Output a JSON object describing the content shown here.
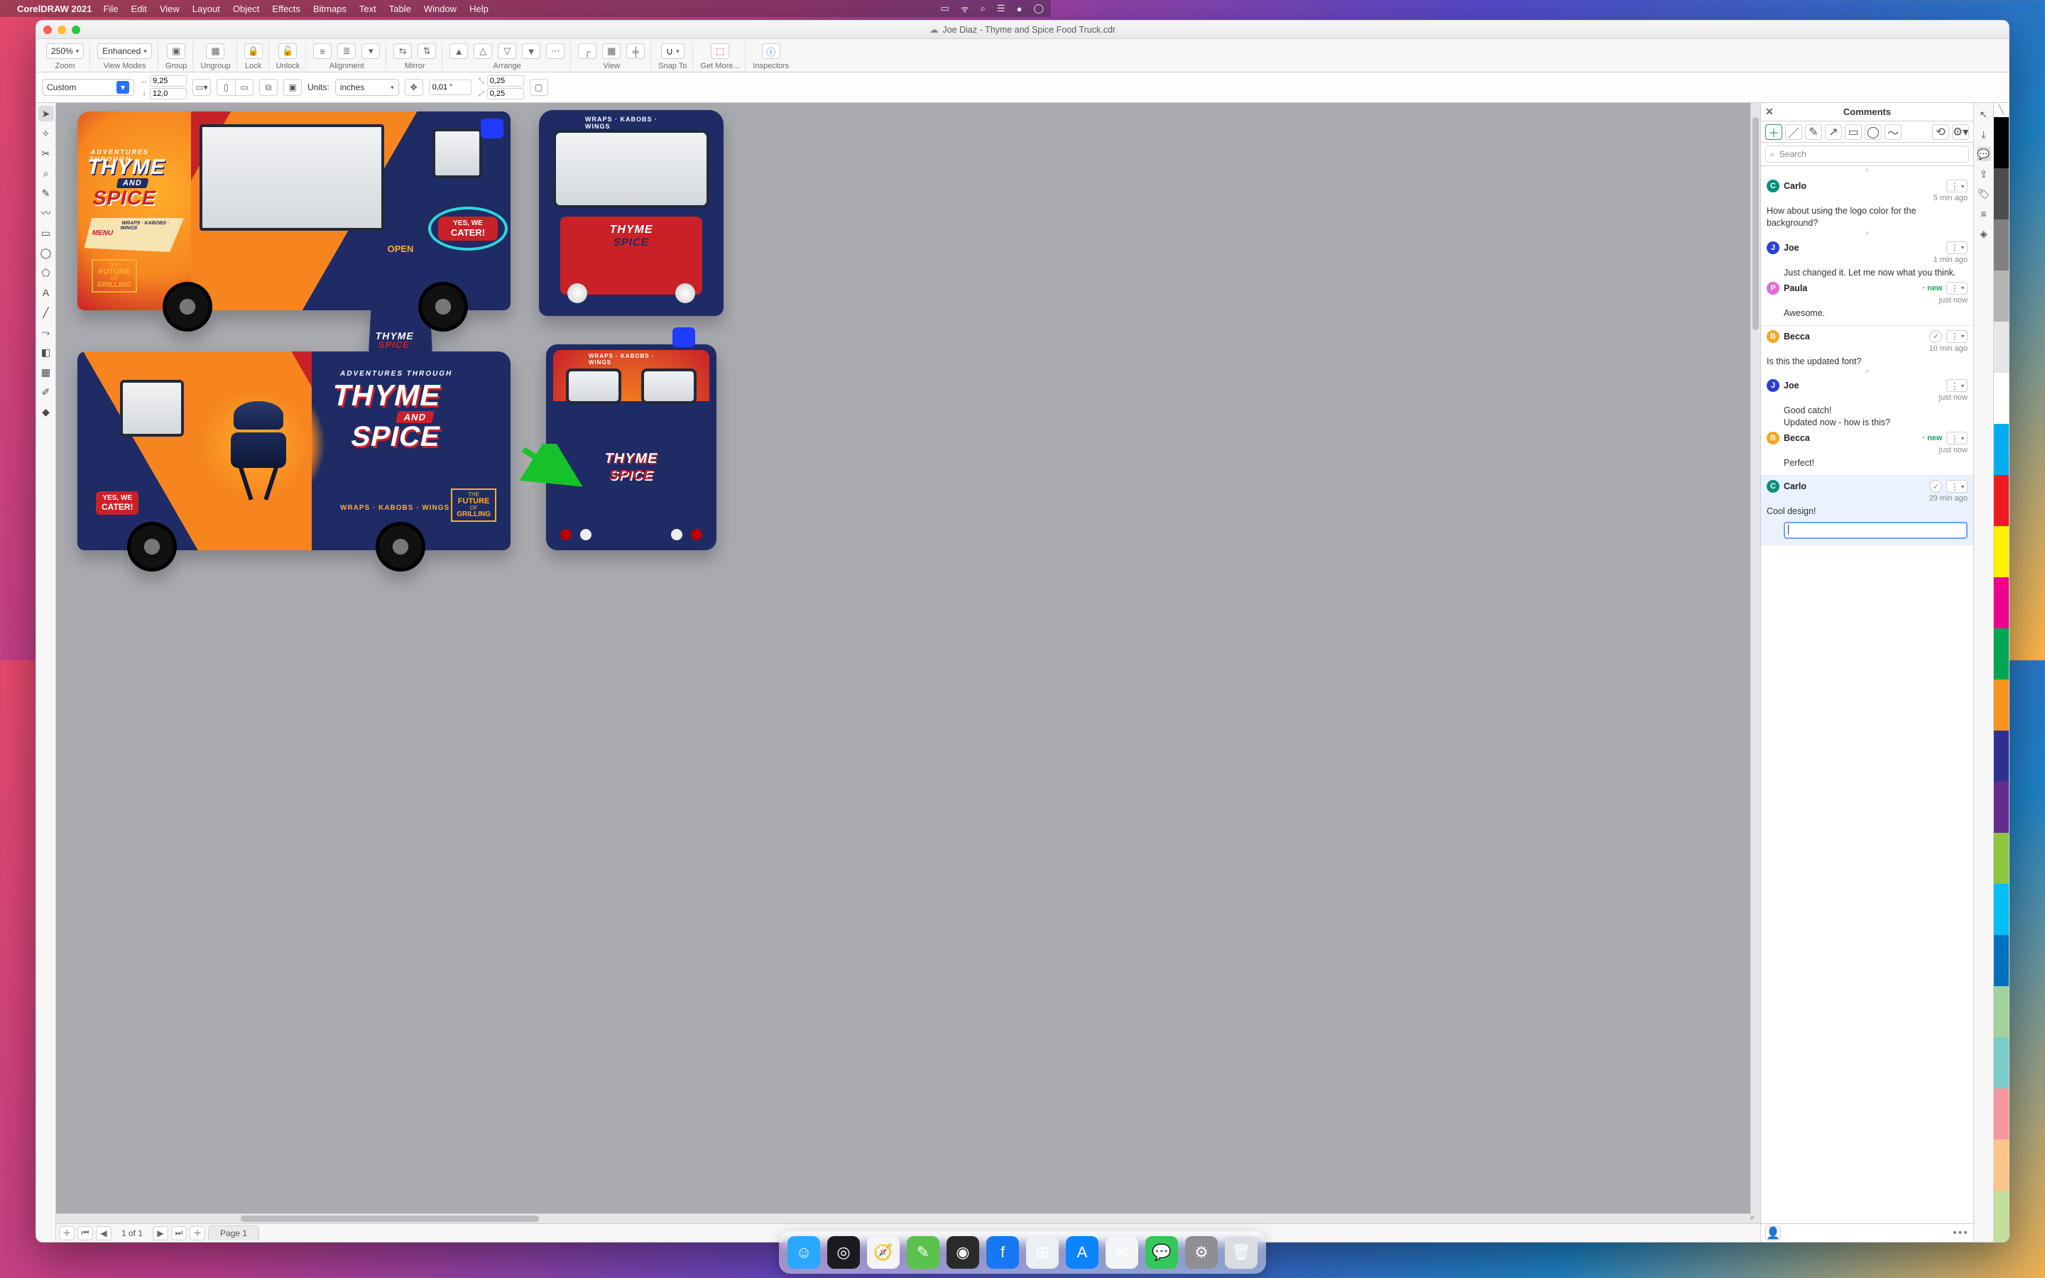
{
  "menubar": {
    "app": "CorelDRAW 2021",
    "items": [
      "File",
      "Edit",
      "View",
      "Layout",
      "Object",
      "Effects",
      "Bitmaps",
      "Text",
      "Table",
      "Window",
      "Help"
    ]
  },
  "window_title": "Joe Diaz - Thyme and Spice Food Truck.cdr",
  "toolbar": {
    "zoom_value": "250% ",
    "zoom_label": "Zoom",
    "viewmodes_value": "Enhanced ",
    "viewmodes_label": "View Modes",
    "group_label": "Group",
    "ungroup_label": "Ungroup",
    "lock_label": "Lock",
    "unlock_label": "Unlock",
    "alignment_label": "Alignment",
    "mirror_label": "Mirror",
    "arrange_label": "Arrange",
    "view_label": "View",
    "snapto_label": "Snap To",
    "getmore_label": "Get More...",
    "inspectors_label": "Inspectors"
  },
  "propbar": {
    "page_preset": "Custom",
    "x": "9,25",
    "y": "12,0",
    "units_label": "Units:",
    "units_value": "inches",
    "nudge": "0,01 \"",
    "dupx": "0,25",
    "dupy": "0,25"
  },
  "canvas_art": {
    "brand_line1": "ADVENTURES THROUGH",
    "brand_thyme": "THYME",
    "brand_and": "AND",
    "brand_spice": "SPICE",
    "tagline": "WRAPS · KABOBS · WINGS",
    "future1": "THE",
    "future2": "FUTURE",
    "future3": "OF",
    "future4": "GRILLING",
    "cater1": "YES, WE",
    "cater2": "CATER!",
    "menu_label": "MENU",
    "open_label": "OPEN"
  },
  "pagetabs": {
    "counter": "1 of 1",
    "tab1": "Page 1"
  },
  "comments_panel": {
    "title": "Comments",
    "search_placeholder": "Search",
    "threads": [
      {
        "id": "t1",
        "avatar": "C",
        "avatar_class": "C",
        "name": "Carlo",
        "time": "5 min ago",
        "text": "How about using the logo color for the background?",
        "new": false,
        "check": false,
        "replies": [
          {
            "avatar": "J",
            "avatar_class": "J",
            "name": "Joe",
            "time": "1 min ago",
            "text": "Just changed it. Let me now what you think.",
            "new": false
          },
          {
            "avatar": "P",
            "avatar_class": "P",
            "name": "Paula",
            "time": "just now",
            "text": "Awesome.",
            "new": true
          }
        ]
      },
      {
        "id": "t2",
        "avatar": "B",
        "avatar_class": "B",
        "name": "Becca",
        "time": "10 min ago",
        "text": "Is this the updated font?",
        "new": false,
        "check": true,
        "replies": [
          {
            "avatar": "J",
            "avatar_class": "J",
            "name": "Joe",
            "time": "just now",
            "text": "Good catch!\nUpdated now - how is this?",
            "new": false
          },
          {
            "avatar": "B",
            "avatar_class": "B",
            "name": "Becca",
            "time": "just now",
            "text": "Perfect!",
            "new": true
          }
        ]
      },
      {
        "id": "t3",
        "avatar": "C",
        "avatar_class": "C",
        "name": "Carlo",
        "time": "29 min ago",
        "text": "Cool design!",
        "new": false,
        "check": true,
        "active": true,
        "show_input": true
      }
    ]
  },
  "swatches": [
    "#000000",
    "#4d4d4d",
    "#808080",
    "#b3b3b3",
    "#e6e6e6",
    "#ffffff",
    "#00aeef",
    "#ed1c24",
    "#fff200",
    "#ec008c",
    "#00a651",
    "#f7941d",
    "#2e3192",
    "#662d91",
    "#8dc63f",
    "#00bff3",
    "#0072bc",
    "#a3d39c",
    "#7accc8",
    "#f5989d",
    "#fdc689",
    "#c4df9b"
  ],
  "dock_apps": [
    {
      "name": "finder",
      "bg": "#2aa7ff",
      "glyph": "☺"
    },
    {
      "name": "siri",
      "bg": "#1b1b1f",
      "glyph": "◎"
    },
    {
      "name": "safari",
      "bg": "#f2f4f7",
      "glyph": "🧭"
    },
    {
      "name": "notes",
      "bg": "#5ac24c",
      "glyph": "✎"
    },
    {
      "name": "photos",
      "bg": "#2a2a2a",
      "glyph": "◉"
    },
    {
      "name": "facebook",
      "bg": "#1877f2",
      "glyph": "f"
    },
    {
      "name": "launchpad",
      "bg": "#eceff3",
      "glyph": "⊞"
    },
    {
      "name": "appstore",
      "bg": "#0a84ff",
      "glyph": "A"
    },
    {
      "name": "mail",
      "bg": "#f2f4f7",
      "glyph": "✉"
    },
    {
      "name": "messages",
      "bg": "#34c759",
      "glyph": "💬"
    },
    {
      "name": "settings",
      "bg": "#8e8e93",
      "glyph": "⚙"
    },
    {
      "name": "trash",
      "bg": "#d9dde2",
      "glyph": "🗑"
    }
  ]
}
